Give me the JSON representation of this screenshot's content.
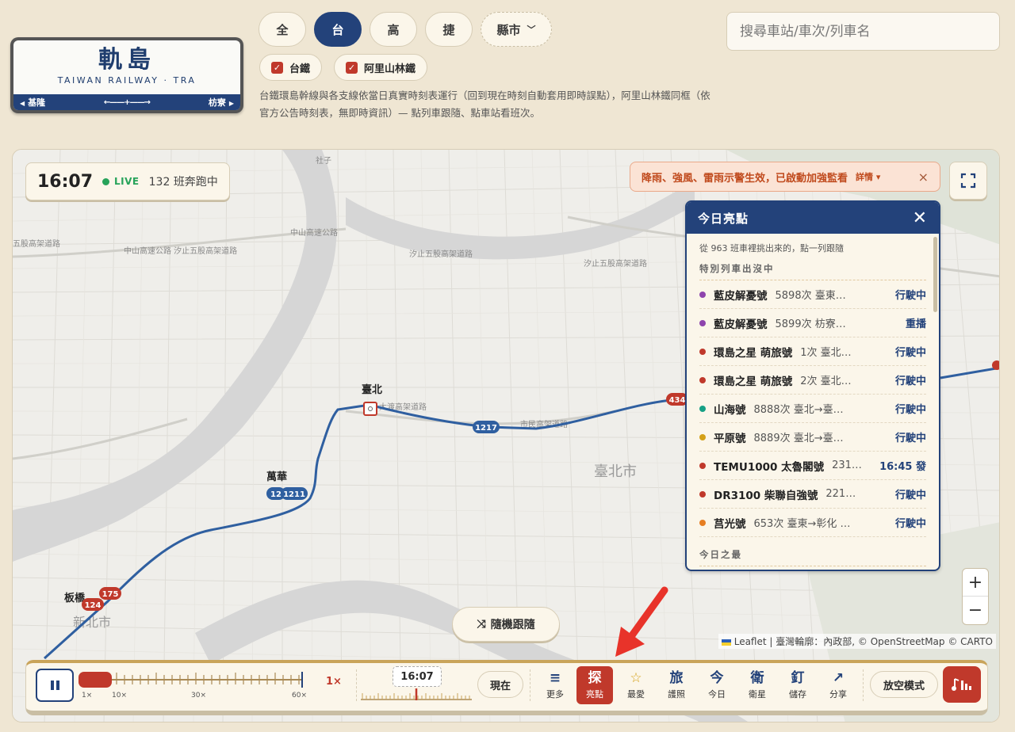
{
  "logo": {
    "title": "軌島",
    "subtitle": "TAIWAN RAILWAY · TRA",
    "left_station": "基隆",
    "right_station": "枋寮"
  },
  "modes": [
    {
      "label": "全",
      "active": false
    },
    {
      "label": "台",
      "active": true
    },
    {
      "label": "高",
      "active": false
    },
    {
      "label": "捷",
      "active": false
    }
  ],
  "county_select": "縣市",
  "filters": [
    {
      "label": "台鐵",
      "checked": true
    },
    {
      "label": "阿里山林鐵",
      "checked": true
    }
  ],
  "description": "台鐵環島幹線與各支線依當日真實時刻表運行（回到現在時刻自動套用即時誤點），阿里山林鐵同框（依官方公告時刻表，無即時資訊）— 點列車跟隨、點車站看班次。",
  "search": {
    "placeholder": "搜尋車站/車次/列車名"
  },
  "status": {
    "time": "16:07",
    "live": "LIVE",
    "count": "132 班奔跑中"
  },
  "alert": {
    "text": "降雨、強風、雷雨示警生效，已啟動加強監看",
    "more": "詳情 ▾",
    "close": "×"
  },
  "map_labels": {
    "taipei_station": "臺北",
    "wanhua": "萬華",
    "banqiao": "板橋",
    "taipei_city": "臺北市",
    "new_taipei": "新北市",
    "shezi": "社子",
    "badge_1217": "1217",
    "badge_1211": "1211",
    "badge_175": "175",
    "badge_124": "124",
    "badge_434": "434",
    "badge_12": "12"
  },
  "panel": {
    "title": "今日亮點",
    "close": "✕",
    "note": "從 963 班車裡挑出來的，點一列跟隨",
    "section1": "特別列車出沒中",
    "section2": "今日之最",
    "rows": [
      {
        "name": "藍皮解憂號",
        "info": "5898次 臺東…",
        "status": "行駛中",
        "color": "#8e44ad"
      },
      {
        "name": "藍皮解憂號",
        "info": "5899次 枋寮…",
        "status": "重播",
        "color": "#8e44ad"
      },
      {
        "name": "環島之星 萌旅號",
        "info": "1次 臺北…",
        "status": "行駛中",
        "color": "#c0392b"
      },
      {
        "name": "環島之星 萌旅號",
        "info": "2次 臺北…",
        "status": "行駛中",
        "color": "#c0392b"
      },
      {
        "name": "山海號",
        "info": "8888次 臺北→臺…",
        "status": "行駛中",
        "color": "#16a085"
      },
      {
        "name": "平原號",
        "info": "8889次 臺北→臺…",
        "status": "行駛中",
        "color": "#d4a017"
      },
      {
        "name": "TEMU1000 太魯閣號",
        "info": "231…",
        "status": "16:45 發",
        "color": "#c0392b"
      },
      {
        "name": "DR3100 柴聯自強號",
        "info": "221…",
        "status": "行駛中",
        "color": "#c0392b"
      },
      {
        "name": "莒光號",
        "info": "653次 臺東→彰化 …",
        "status": "行駛中",
        "color": "#e67e22"
      }
    ]
  },
  "zoom": {
    "in": "+",
    "out": "−"
  },
  "attribution": "Leaflet | 臺灣輪廓：內政部, © OpenStreetMap © CARTO",
  "random_follow": "隨機跟隨",
  "controls": {
    "speed_labels": [
      "1×",
      "10×",
      "30×",
      "60×"
    ],
    "rate": "1×",
    "time": "16:07",
    "now": "現在",
    "tools": [
      {
        "icon": "≡",
        "label": "更多"
      },
      {
        "icon": "探",
        "label": "亮點"
      },
      {
        "icon": "☆",
        "label": "最愛"
      },
      {
        "icon": "旅",
        "label": "護照"
      },
      {
        "icon": "今",
        "label": "今日"
      },
      {
        "icon": "衛",
        "label": "衛星"
      },
      {
        "icon": "釘",
        "label": "儲存"
      },
      {
        "icon": "↗",
        "label": "分享"
      }
    ],
    "airplane": "放空模式"
  },
  "colors": {
    "navy": "#23427a",
    "accent_red": "#c0392b",
    "rail_line": "#2f5fa0",
    "bg": "#efe6d3"
  }
}
